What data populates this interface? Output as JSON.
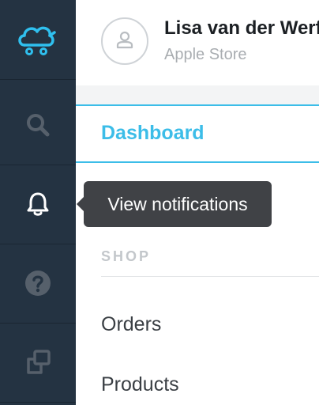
{
  "rail": {
    "items": [
      {
        "icon": "cloud-cart-logo-icon",
        "color": "#2fc0ef"
      },
      {
        "icon": "search-icon",
        "color": "#56606b"
      },
      {
        "icon": "bell-icon",
        "color": "#ffffff",
        "active": true
      },
      {
        "icon": "help-icon",
        "color": "#56606b"
      },
      {
        "icon": "windows-icon",
        "color": "#56606b"
      }
    ]
  },
  "user": {
    "name": "Lisa van der Werf",
    "store": "Apple Store",
    "avatar_icon": "user-icon"
  },
  "nav": {
    "dashboard_label": "Dashboard",
    "section_heading": "SHOP",
    "items": [
      {
        "label": "Orders"
      },
      {
        "label": "Products"
      }
    ]
  },
  "tooltip": {
    "text": "View notifications"
  },
  "colors": {
    "accent": "#3cbde8",
    "rail_bg": "#243342",
    "tooltip_bg": "#404246"
  }
}
